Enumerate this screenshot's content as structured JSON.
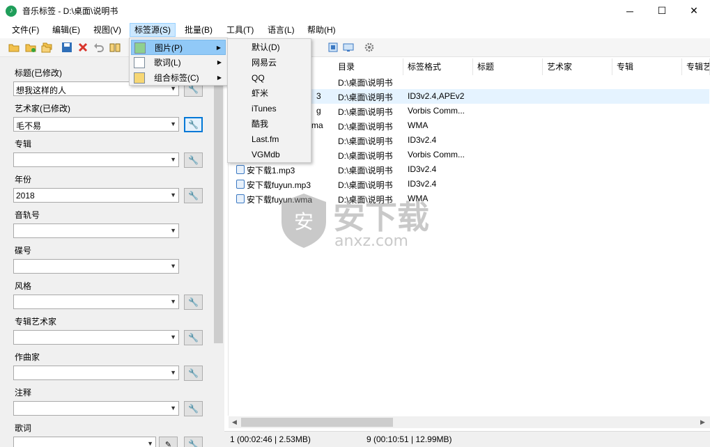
{
  "window": {
    "title": "音乐标签 - D:\\桌面\\说明书",
    "minimize_glyph": "─",
    "maximize_glyph": "☐",
    "close_glyph": "✕"
  },
  "menubar": {
    "items": [
      {
        "label": "文件(F)"
      },
      {
        "label": "编辑(E)"
      },
      {
        "label": "视图(V)"
      },
      {
        "label": "标签源(S)"
      },
      {
        "label": "批量(B)"
      },
      {
        "label": "工具(T)"
      },
      {
        "label": "语言(L)"
      },
      {
        "label": "帮助(H)"
      }
    ]
  },
  "tag_source_menu": {
    "items": [
      {
        "label": "图片(P)"
      },
      {
        "label": "歌词(L)"
      },
      {
        "label": "组合标签(C)"
      }
    ]
  },
  "picture_submenu": {
    "items": [
      {
        "label": "默认(D)"
      },
      {
        "label": "网易云"
      },
      {
        "label": "QQ"
      },
      {
        "label": "虾米"
      },
      {
        "label": "iTunes"
      },
      {
        "label": "酷我"
      },
      {
        "label": "Last.fm"
      },
      {
        "label": "VGMdb"
      }
    ]
  },
  "fields": [
    {
      "label": "标题(已修改)",
      "value": "想我这样的人"
    },
    {
      "label": "艺术家(已修改)",
      "value": "毛不易"
    },
    {
      "label": "专辑",
      "value": ""
    },
    {
      "label": "年份",
      "value": "2018"
    },
    {
      "label": "音轨号",
      "value": ""
    },
    {
      "label": "碟号",
      "value": ""
    },
    {
      "label": "风格",
      "value": ""
    },
    {
      "label": "专辑艺术家",
      "value": ""
    },
    {
      "label": "作曲家",
      "value": ""
    },
    {
      "label": "注释",
      "value": ""
    },
    {
      "label": "歌词",
      "value": ""
    }
  ],
  "list": {
    "columns": [
      {
        "label": "目录"
      },
      {
        "label": "标签格式"
      },
      {
        "label": "标题"
      },
      {
        "label": "艺术家"
      },
      {
        "label": "专辑"
      },
      {
        "label": "专辑艺"
      }
    ],
    "rows": [
      {
        "name": "",
        "dir": "D:\\桌面\\说明书",
        "format": ""
      },
      {
        "name": "3",
        "dir": "D:\\桌面\\说明书",
        "format": "ID3v2.4,APEv2"
      },
      {
        "name": "g",
        "dir": "D:\\桌面\\说明书",
        "format": "Vorbis Comm..."
      },
      {
        "name": "ma",
        "dir": "D:\\桌面\\说明书",
        "format": "WMA"
      },
      {
        "name": "",
        "dir": "D:\\桌面\\说明书",
        "format": "ID3v2.4"
      },
      {
        "name": "",
        "dir": "D:\\桌面\\说明书",
        "format": "Vorbis Comm..."
      },
      {
        "name": "安下载1.mp3",
        "dir": "D:\\桌面\\说明书",
        "format": "ID3v2.4"
      },
      {
        "name": "安下载fuyun.mp3",
        "dir": "D:\\桌面\\说明书",
        "format": "ID3v2.4"
      },
      {
        "name": "安下载fuyun.wma",
        "dir": "D:\\桌面\\说明书",
        "format": "WMA"
      }
    ]
  },
  "status": {
    "selected": "1 (00:02:46 | 2.53MB)",
    "total": "9 (00:10:51 | 12.99MB)"
  },
  "watermark": {
    "text": "安下载",
    "sub": "anxz.com"
  },
  "colors": {
    "accent": "#0078d7",
    "menu_highlight": "#91c9f7",
    "selected_row": "#e5f3ff"
  }
}
